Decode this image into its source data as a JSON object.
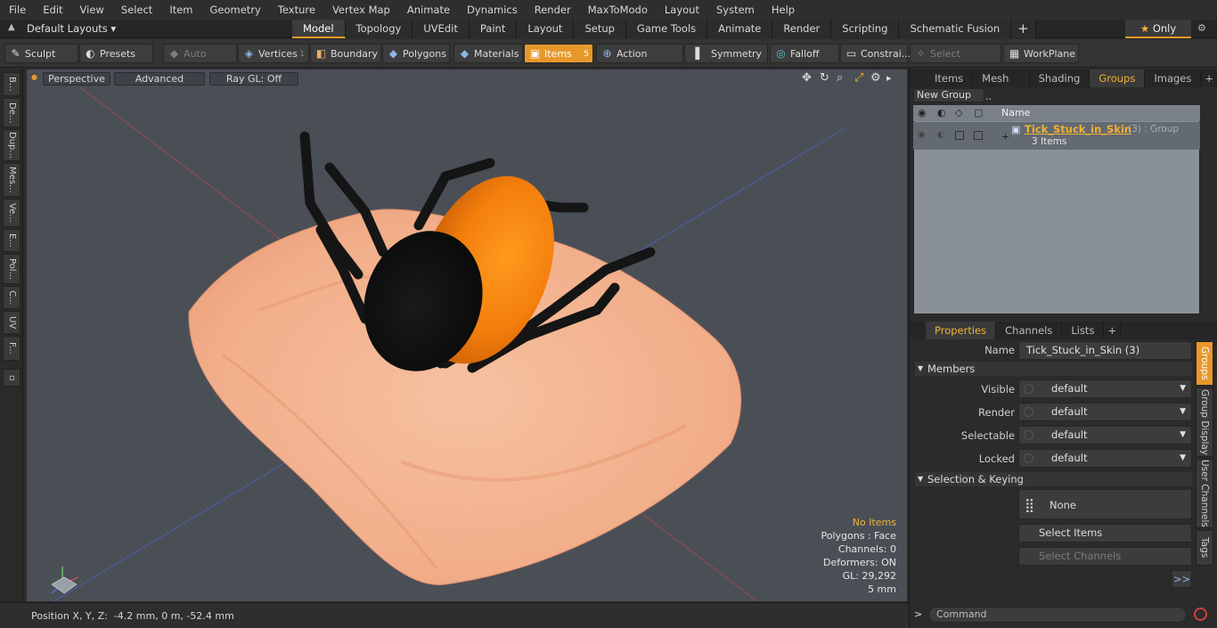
{
  "menu": [
    "File",
    "Edit",
    "View",
    "Select",
    "Item",
    "Geometry",
    "Texture",
    "Vertex Map",
    "Animate",
    "Dynamics",
    "Render",
    "MaxToModo",
    "Layout",
    "System",
    "Help"
  ],
  "layout_select": "Default Layouts",
  "layout_tabs": [
    "Model",
    "Topology",
    "UVEdit",
    "Paint",
    "Layout",
    "Setup",
    "Game Tools",
    "Animate",
    "Render",
    "Scripting",
    "Schematic Fusion"
  ],
  "only_label": "Only",
  "toolbar": {
    "sculpt": "Sculpt",
    "presets": "Presets",
    "auto_select": "Auto Select",
    "vertices": "Vertices",
    "vertices_count": "1",
    "boundary": "Boundary",
    "polygons": "Polygons",
    "materials": "Materials",
    "items": "Items",
    "items_count": "5",
    "action_center": "Action Center",
    "symmetry": "Symmetry",
    "falloff": "Falloff",
    "constraints": "Constrai...",
    "select_through": "Select Through",
    "workplane": "WorkPlane"
  },
  "left_tabs": [
    "B...",
    "De...",
    "Dup...",
    "Mes...",
    "Ve...",
    "E...",
    "Pol...",
    "C...",
    "UV",
    "F..."
  ],
  "viewport": {
    "perspective": "Perspective",
    "advanced": "Advanced",
    "raygl": "Ray GL: Off",
    "info": {
      "no_items": "No Items",
      "polygons": "Polygons : Face",
      "channels": "Channels: 0",
      "deformers": "Deformers: ON",
      "gl": "GL: 29,292",
      "scale": "5 mm"
    }
  },
  "status": {
    "position_label": "Position X, Y, Z:",
    "position_value": "-4.2 mm, 0 m, -52.4 mm"
  },
  "top_panel_tabs": [
    "Items",
    "Mesh ...",
    "Shading",
    "Groups",
    "Images"
  ],
  "groups": {
    "new_group": "New Group",
    "header_name": "Name",
    "item_name": "Tick_Stuck_in_Skin",
    "item_suffix": "(3) : Group",
    "item_sub": "3 Items"
  },
  "bottom_panel_tabs": [
    "Properties",
    "Channels",
    "Lists"
  ],
  "properties": {
    "name_label": "Name",
    "name_value": "Tick_Stuck_in_Skin (3)",
    "members": "Members",
    "visible_label": "Visible",
    "visible_value": "default",
    "render_label": "Render",
    "render_value": "default",
    "selectable_label": "Selectable",
    "selectable_value": "default",
    "locked_label": "Locked",
    "locked_value": "default",
    "selection_keying": "Selection & Keying",
    "none_label": "None",
    "select_items": "Select Items",
    "select_channels": "Select Channels",
    "more": ">>"
  },
  "right_vtabs": [
    "Groups",
    "Group Display",
    "User Channels",
    "Tags"
  ],
  "command_placeholder": "Command",
  "colors": {
    "accent": "#e8982a",
    "highlight_text": "#f2b232",
    "viewport_bg": "#4a4f56"
  }
}
